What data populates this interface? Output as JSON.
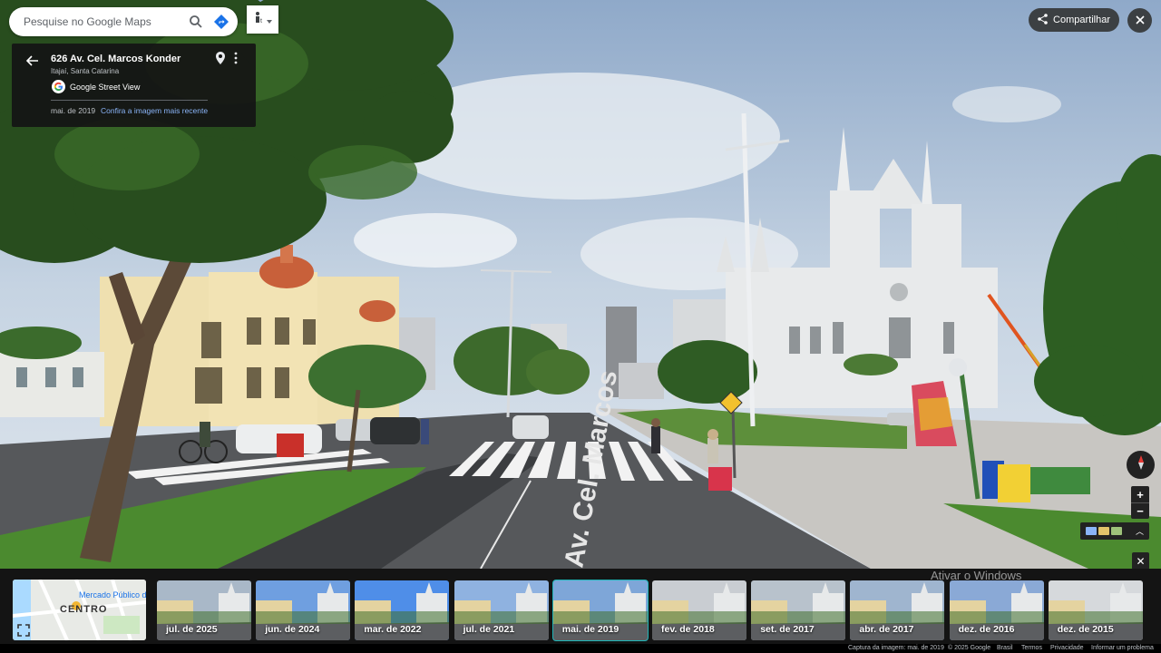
{
  "search": {
    "placeholder": "Pesquise no Google Maps"
  },
  "info_panel": {
    "address": "626 Av. Cel. Marcos Konder",
    "city": "Itajaí, Santa Catarina",
    "provider": "Google Street View",
    "capture_date": "mai. de 2019",
    "recent_link": "Confira a imagem mais recente"
  },
  "top_right": {
    "share_label": "Compartilhar"
  },
  "scene": {
    "street_text": "Av. Cel. Marcos"
  },
  "minimap": {
    "place_label": "Mercado Público de",
    "area_label": "CENTRO"
  },
  "timeline": [
    {
      "label": "jul. de 2025",
      "selected": false
    },
    {
      "label": "jun. de 2024",
      "selected": false
    },
    {
      "label": "mar. de 2022",
      "selected": false
    },
    {
      "label": "jul. de 2021",
      "selected": false
    },
    {
      "label": "mai. de 2019",
      "selected": true
    },
    {
      "label": "fev. de 2018",
      "selected": false
    },
    {
      "label": "set. de 2017",
      "selected": false
    },
    {
      "label": "abr. de 2017",
      "selected": false
    },
    {
      "label": "dez. de 2016",
      "selected": false
    },
    {
      "label": "dez. de 2015",
      "selected": false
    }
  ],
  "windows_watermark": "Ativar o Windows",
  "footer": {
    "capture": "Captura da imagem: mai. de 2019",
    "copyright": "© 2025 Google",
    "country": "Brasil",
    "terms": "Termos",
    "privacy": "Privacidade",
    "report": "Informar um problema"
  },
  "colors": {
    "selected_outline": "#1fb5b7",
    "link": "#8ab4f8",
    "panel_bg": "#141414"
  }
}
